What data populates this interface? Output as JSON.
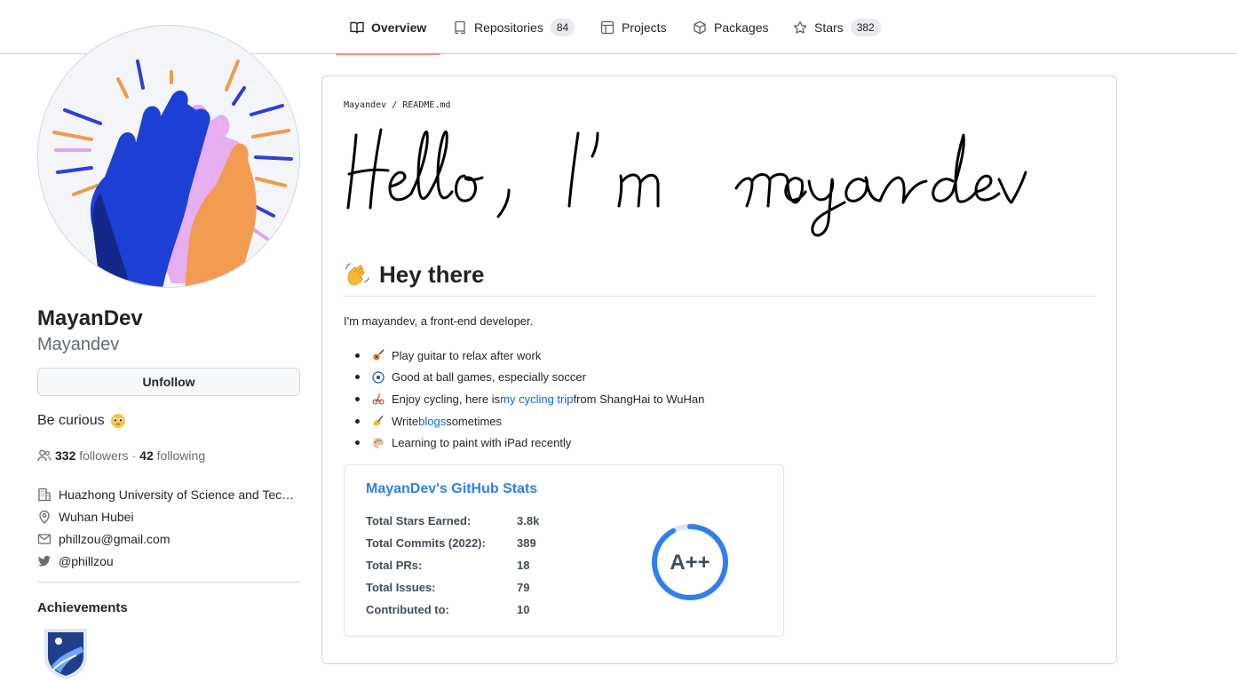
{
  "nav": {
    "tabs": [
      {
        "label": "Overview",
        "icon": "book-icon",
        "active": true
      },
      {
        "label": "Repositories",
        "icon": "repo-icon",
        "count": "84"
      },
      {
        "label": "Projects",
        "icon": "project-table-icon"
      },
      {
        "label": "Packages",
        "icon": "package-icon"
      },
      {
        "label": "Stars",
        "icon": "star-icon",
        "count": "382"
      }
    ]
  },
  "profile": {
    "fullname": "MayanDev",
    "username": "Mayandev",
    "unfollow_label": "Unfollow",
    "bio": "Be curious",
    "followers_count": "332",
    "followers_label": "followers",
    "separator": "·",
    "following_count": "42",
    "following_label": "following",
    "organization": "Huazhong University of Science and Technology",
    "location": "Wuhan Hubei",
    "email": "phillzou@gmail.com",
    "twitter": "@phillzou",
    "achievements_title": "Achievements"
  },
  "readme": {
    "owner": "Mayandev",
    "sep": "/",
    "file": "README.md",
    "handwriting": "Hello, I'm mayandev",
    "heading": "Hey there",
    "intro": "I'm mayandev, a front-end developer.",
    "items": [
      {
        "emoji": "guitar",
        "text_before": "Play guitar to relax after work",
        "link": "",
        "text_after": ""
      },
      {
        "emoji": "soccer-ball",
        "text_before": "Good at ball games, especially soccer",
        "link": "",
        "text_after": ""
      },
      {
        "emoji": "cyclist",
        "text_before": "Enjoy cycling, here is ",
        "link": "my cycling trip",
        "text_after": " from ShangHai to WuHan"
      },
      {
        "emoji": "writing-hand",
        "text_before": "Write ",
        "link": "blogs",
        "text_after": " sometimes"
      },
      {
        "emoji": "palette",
        "text_before": "Learning to paint with iPad recently",
        "link": "",
        "text_after": ""
      }
    ]
  },
  "stats": {
    "title": "MayanDev's GitHub Stats",
    "rows": [
      {
        "label": "Total Stars Earned:",
        "value": "3.8k"
      },
      {
        "label": "Total Commits (2022):",
        "value": "389"
      },
      {
        "label": "Total PRs:",
        "value": "18"
      },
      {
        "label": "Total Issues:",
        "value": "79"
      },
      {
        "label": "Contributed to:",
        "value": "10"
      }
    ],
    "rank": "A++",
    "rank_progress_pct": 92,
    "colors": {
      "title": "#2f80ed",
      "ring": "#2f80ed",
      "ring_track": "#dbe7f8"
    }
  },
  "colors": {
    "accent_underline": "#fd8c73",
    "link": "#0969da",
    "border": "#d0d7de"
  }
}
